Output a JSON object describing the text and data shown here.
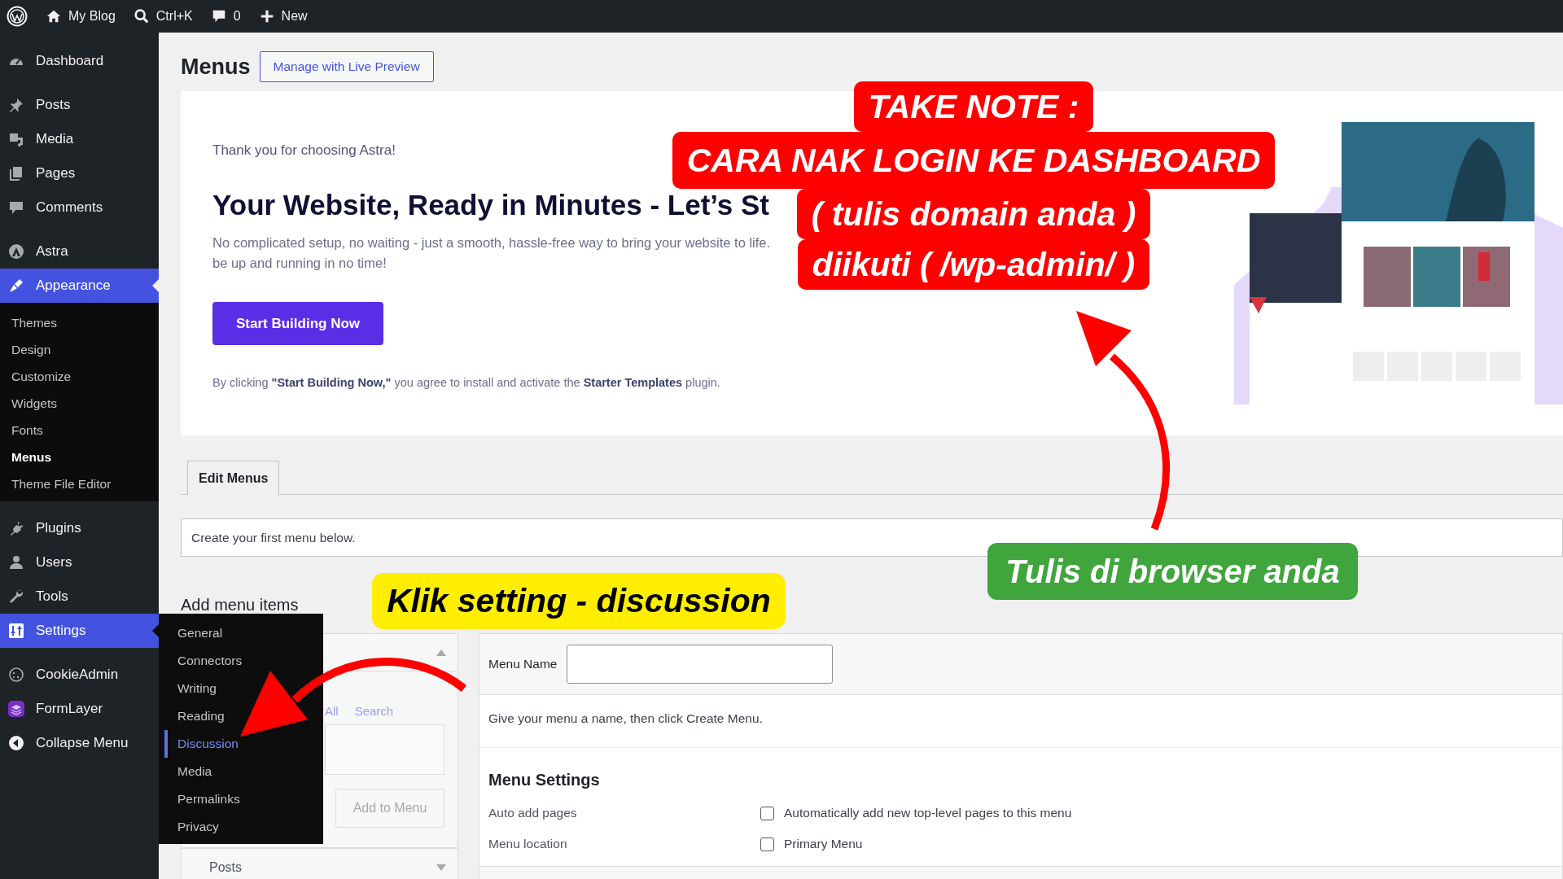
{
  "admin_bar": {
    "items": [
      {
        "label": "My Blog"
      },
      {
        "label": "Ctrl+K"
      },
      {
        "label": "0"
      },
      {
        "label": "New"
      }
    ]
  },
  "sidebar": {
    "groups": [
      [
        {
          "label": "Dashboard",
          "selected": false,
          "hovered": false
        }
      ],
      [
        {
          "label": "Posts",
          "selected": false,
          "hovered": false
        },
        {
          "label": "Media",
          "selected": false,
          "hovered": false
        },
        {
          "label": "Pages",
          "selected": false,
          "hovered": false
        },
        {
          "label": "Comments",
          "selected": false,
          "hovered": false
        }
      ],
      [
        {
          "label": "Astra",
          "selected": false,
          "hovered": false
        },
        {
          "label": "Appearance",
          "selected": true,
          "hovered": false,
          "children": [
            {
              "label": "Themes",
              "selected": false
            },
            {
              "label": "Design",
              "selected": false
            },
            {
              "label": "Customize",
              "selected": false
            },
            {
              "label": "Widgets",
              "selected": false
            },
            {
              "label": "Fonts",
              "selected": false
            },
            {
              "label": "Menus",
              "selected": true
            },
            {
              "label": "Theme File Editor",
              "selected": false
            }
          ]
        }
      ],
      [
        {
          "label": "Plugins",
          "selected": false,
          "hovered": false
        },
        {
          "label": "Users",
          "selected": false,
          "hovered": false
        },
        {
          "label": "Tools",
          "selected": false,
          "hovered": false
        },
        {
          "label": "Settings",
          "selected": false,
          "hovered": true,
          "children": [
            {
              "label": "General",
              "selected": false
            },
            {
              "label": "Connectors",
              "selected": false
            },
            {
              "label": "Writing",
              "selected": false
            },
            {
              "label": "Reading",
              "selected": false
            },
            {
              "label": "Discussion",
              "selected": true
            },
            {
              "label": "Media",
              "selected": false
            },
            {
              "label": "Permalinks",
              "selected": false
            },
            {
              "label": "Privacy",
              "selected": false
            }
          ]
        }
      ],
      [
        {
          "label": "CookieAdmin",
          "selected": false,
          "hovered": false
        },
        {
          "label": "FormLayer",
          "selected": false,
          "hovered": false
        },
        {
          "label": "Collapse Menu",
          "selected": false,
          "hovered": false
        }
      ]
    ]
  },
  "page": {
    "title": "Menus",
    "action_button": "Manage with Live Preview"
  },
  "banner": {
    "intro": "Thank you for choosing Astra!",
    "heading": "Your Website, Ready in Minutes - Let’s St",
    "description": [
      "No complicated setup, no waiting - just a smooth, hassle-free way to bring your website to life.",
      "be up and running in no time!"
    ],
    "button": "Start Building Now",
    "consent": "By clicking **\"Start Building Now,\"** you agree to install and activate the **Starter Templates** plugin."
  },
  "tabs": [
    {
      "label": "Edit Menus",
      "selected": true
    }
  ],
  "notice": "Create your first menu below.",
  "add_items": {
    "heading": "Add menu items",
    "sections": [
      {
        "expanded": true,
        "links": [
          "All",
          "Search"
        ],
        "button": "Add to Menu"
      },
      {
        "label": "Posts",
        "expanded": false
      }
    ]
  },
  "menu_editor": {
    "name_label": "Menu Name",
    "hint": "Give your menu a name, then click Create Menu.",
    "settings_heading": "Menu Settings",
    "settings": [
      {
        "label": "Auto add pages",
        "option": "Automatically add new top-level pages to this menu",
        "checked": false
      },
      {
        "label": "Menu location",
        "option": "Primary Menu",
        "checked": false
      }
    ]
  },
  "annotations": [
    {
      "kind": "red_note",
      "lines": [
        "TAKE NOTE :",
        "CARA NAK LOGIN KE DASHBOARD",
        "( tulis domain anda )",
        "diikuti ( /wp-admin/ )"
      ]
    },
    {
      "kind": "green_label",
      "text": "Tulis di browser anda"
    },
    {
      "kind": "yellow_label",
      "text": "Klik setting - discussion"
    }
  ]
}
